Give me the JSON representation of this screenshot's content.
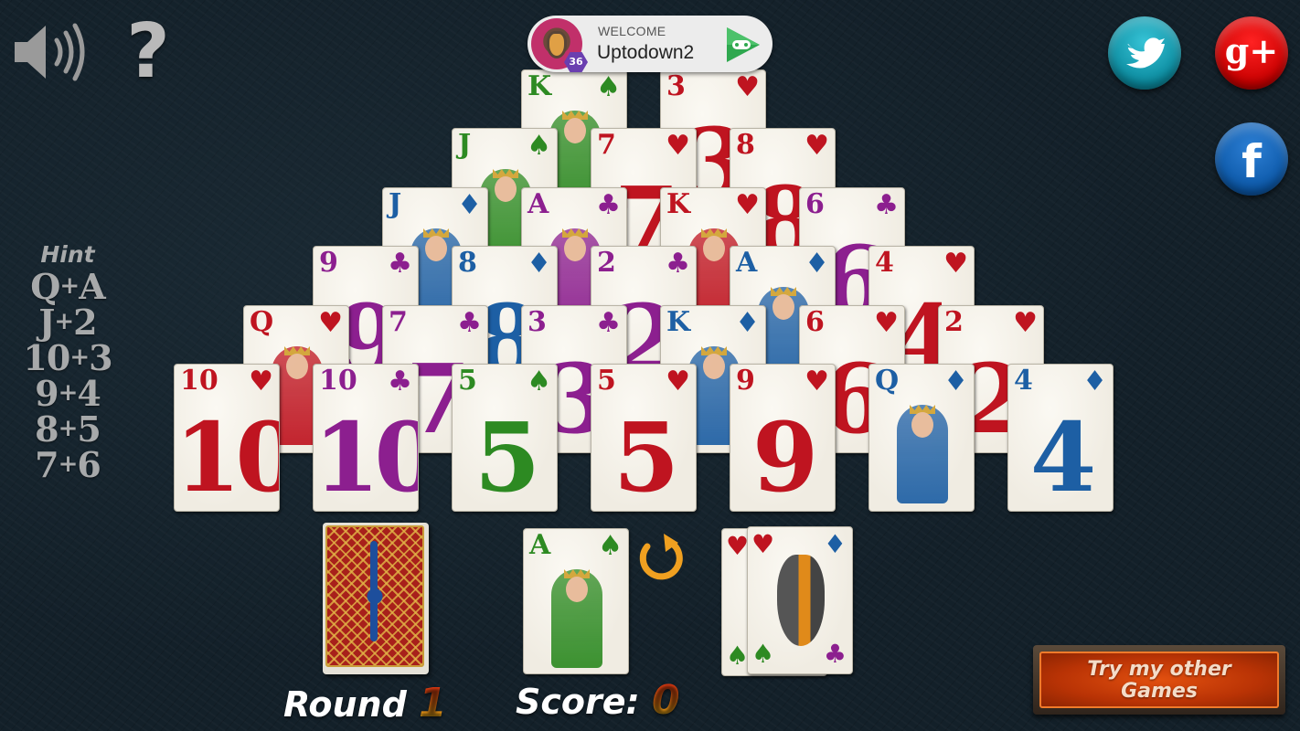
{
  "top_controls": {
    "sound_icon": "speaker-volume-icon",
    "help_icon": "question-mark-icon",
    "help_glyph": "?"
  },
  "player": {
    "welcome": "WELCOME",
    "username": "Uptodown2",
    "level": "36",
    "games_icon": "google-play-games-icon"
  },
  "social": {
    "twitter_icon": "twitter-icon",
    "gplus_label": "g+",
    "facebook_label": "f"
  },
  "hint": {
    "title": "Hint",
    "pairs": [
      {
        "a": "Q",
        "b": "A"
      },
      {
        "a": "J",
        "b": "2"
      },
      {
        "a": "10",
        "b": "3"
      },
      {
        "a": "9",
        "b": "4"
      },
      {
        "a": "8",
        "b": "5"
      },
      {
        "a": "7",
        "b": "6"
      }
    ],
    "plus": "+"
  },
  "pyramid": {
    "rows": [
      [
        {
          "rank": "K",
          "suit": "spade",
          "color": "green",
          "face": true
        },
        {
          "rank": "3",
          "suit": "heart",
          "color": "red",
          "face": false
        }
      ],
      [
        {
          "rank": "J",
          "suit": "spade",
          "color": "green",
          "face": true
        },
        {
          "rank": "7",
          "suit": "heart",
          "color": "red",
          "face": false
        },
        {
          "rank": "8",
          "suit": "heart",
          "color": "red",
          "face": false
        }
      ],
      [
        {
          "rank": "J",
          "suit": "diamond",
          "color": "blue",
          "face": true
        },
        {
          "rank": "A",
          "suit": "club",
          "color": "purple",
          "face": true
        },
        {
          "rank": "K",
          "suit": "heart",
          "color": "red",
          "face": true
        },
        {
          "rank": "6",
          "suit": "club",
          "color": "purple",
          "face": false
        }
      ],
      [
        {
          "rank": "9",
          "suit": "club",
          "color": "purple",
          "face": false
        },
        {
          "rank": "8",
          "suit": "diamond",
          "color": "blue",
          "face": false
        },
        {
          "rank": "2",
          "suit": "club",
          "color": "purple",
          "face": false
        },
        {
          "rank": "A",
          "suit": "diamond",
          "color": "blue",
          "face": true
        },
        {
          "rank": "4",
          "suit": "heart",
          "color": "red",
          "face": false
        }
      ],
      [
        {
          "rank": "Q",
          "suit": "heart",
          "color": "red",
          "face": true
        },
        {
          "rank": "7",
          "suit": "club",
          "color": "purple",
          "face": false
        },
        {
          "rank": "3",
          "suit": "club",
          "color": "purple",
          "face": false
        },
        {
          "rank": "K",
          "suit": "diamond",
          "color": "blue",
          "face": true
        },
        {
          "rank": "6",
          "suit": "heart",
          "color": "red",
          "face": false
        },
        {
          "rank": "2",
          "suit": "heart",
          "color": "red",
          "face": false
        }
      ],
      [
        {
          "rank": "10",
          "suit": "heart",
          "color": "red",
          "face": false
        },
        {
          "rank": "10",
          "suit": "club",
          "color": "purple",
          "face": false
        },
        {
          "rank": "5",
          "suit": "spade",
          "color": "green",
          "face": false
        },
        {
          "rank": "5",
          "suit": "heart",
          "color": "red",
          "face": false
        },
        {
          "rank": "9",
          "suit": "heart",
          "color": "red",
          "face": false
        },
        {
          "rank": "Q",
          "suit": "diamond",
          "color": "blue",
          "face": true
        },
        {
          "rank": "4",
          "suit": "diamond",
          "color": "blue",
          "face": false
        }
      ]
    ]
  },
  "waste": {
    "rank": "A",
    "suit": "spade",
    "color": "green",
    "face": true
  },
  "jokers": {
    "label": "dragon-joker-cards",
    "count": 2
  },
  "undo_icon": "undo-arrow-icon",
  "hud": {
    "round_label": "Round",
    "round_value": "1",
    "score_label": "Score:",
    "score_value": "0"
  },
  "try_games": {
    "line1": "Try my other",
    "line2": "Games"
  },
  "colors": {
    "red": "#bf1420",
    "purple": "#8c1f8f",
    "green": "#2d8a22",
    "blue": "#1d5fa4",
    "table": "#132029",
    "accent_orange": "#e2500f"
  },
  "suit_glyphs": {
    "heart": "♥",
    "club": "♣",
    "spade": "♠",
    "diamond": "♦"
  }
}
